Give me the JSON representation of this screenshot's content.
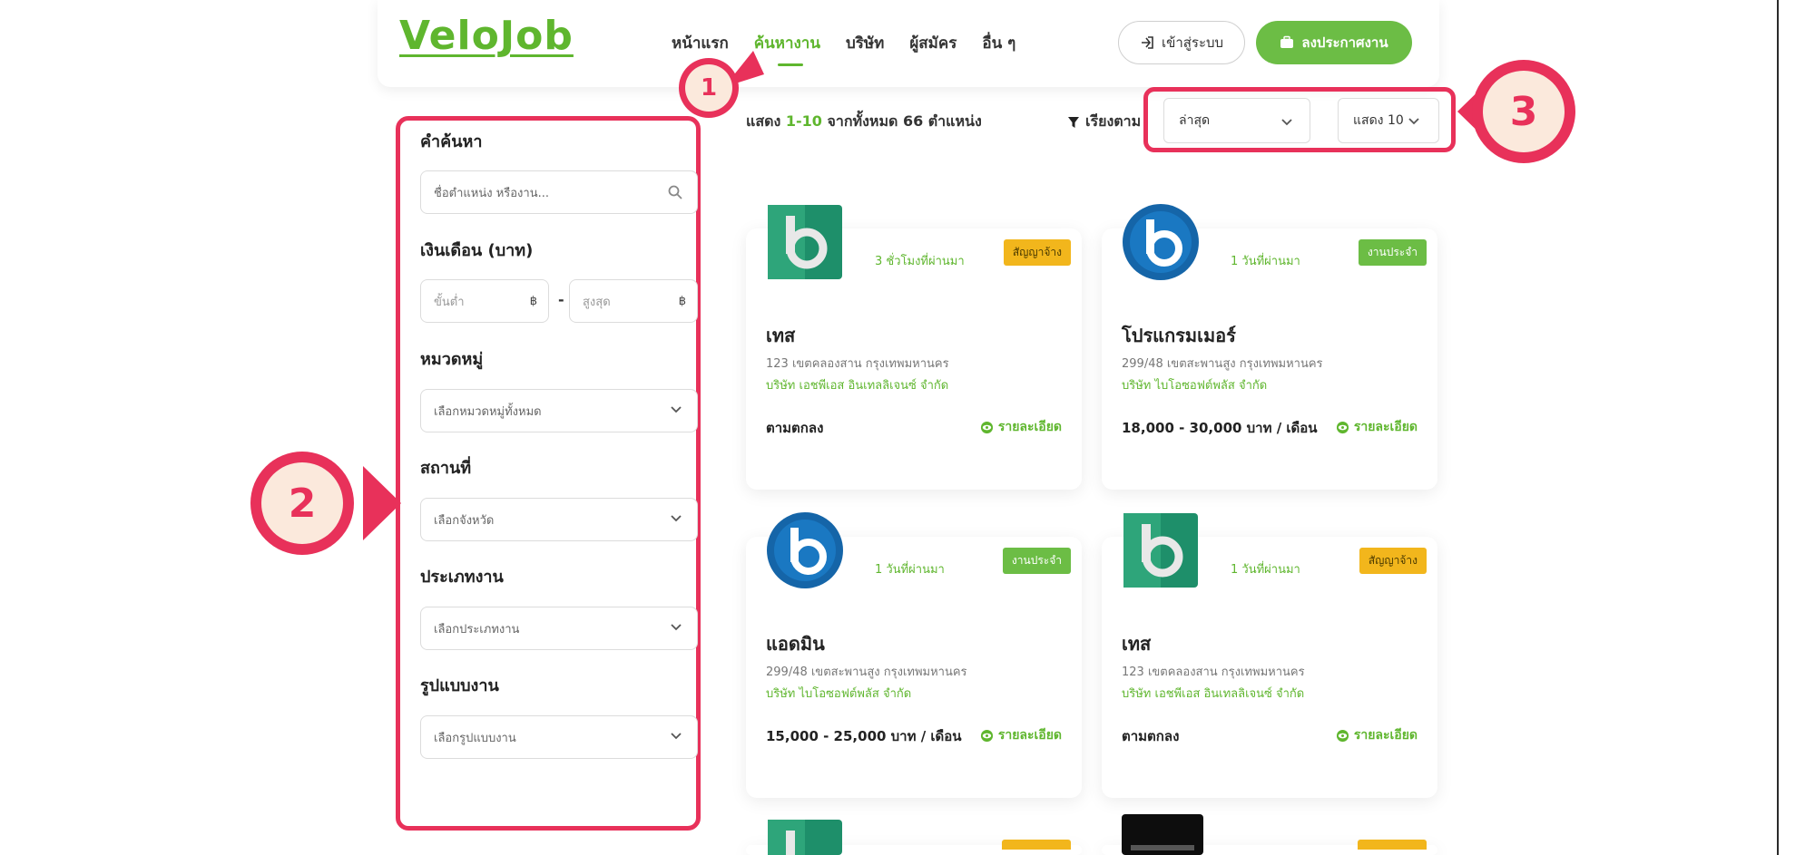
{
  "header": {
    "logo": "VeloJob",
    "nav": [
      {
        "label": "หน้าแรก",
        "active": false
      },
      {
        "label": "ค้นหางาน",
        "active": true
      },
      {
        "label": "บริษัท",
        "active": false
      },
      {
        "label": "ผู้สมัคร",
        "active": false
      },
      {
        "label": "อื่น ๆ",
        "active": false
      }
    ],
    "login_label": "เข้าสู่ระบบ",
    "post_job_label": "ลงประกาศงาน"
  },
  "filters": {
    "keyword_label": "คำค้นหา",
    "keyword_placeholder": "ชื่อตำแหน่ง หรืองาน...",
    "salary_label": "เงินเดือน (บาท)",
    "salary_min_placeholder": "ขั้นต่ำ",
    "salary_max_placeholder": "สูงสุด",
    "salary_dash": "-",
    "currency_symbol": "฿",
    "category_label": "หมวดหมู่",
    "category_value": "เลือกหมวดหมู่ทั้งหมด",
    "location_label": "สถานที่",
    "location_value": "เลือกจังหวัด",
    "jobtype_label": "ประเภทงาน",
    "jobtype_value": "เลือกประเภทงาน",
    "workstyle_label": "รูปแบบงาน",
    "workstyle_value": "เลือกรูปแบบงาน"
  },
  "results": {
    "prefix": "แสดง",
    "range": "1-10",
    "suffix": "จากทั้งหมด 66 ตำแหน่ง",
    "sort_label": "เรียงตาม",
    "sort_value": "ล่าสุด",
    "show_value": "แสดง 10"
  },
  "jobs": [
    {
      "title": "เทส",
      "posted": "3 ชั่วโมงที่ผ่านมา",
      "badge": "สัญญาจ้าง",
      "badge_color": "yellow",
      "address": "123 เขตคลองสาน กรุงเทพมหานคร",
      "company": "บริษัท เอชพีเอส อินเทลลิเจนซ์ จำกัด",
      "salary": "ตามตกลง",
      "detail": "รายละเอียด",
      "logo_style": "green"
    },
    {
      "title": "โปรแกรมเมอร์",
      "posted": "1 วันที่ผ่านมา",
      "badge": "งานประจำ",
      "badge_color": "green",
      "address": "299/48 เขตสะพานสูง กรุงเทพมหานคร",
      "company": "บริษัท ไบโอซอฟต์พลัส จำกัด",
      "salary": "18,000 - 30,000 บาท / เดือน",
      "detail": "รายละเอียด",
      "logo_style": "blue"
    },
    {
      "title": "แอดมิน",
      "posted": "1 วันที่ผ่านมา",
      "badge": "งานประจำ",
      "badge_color": "green",
      "address": "299/48 เขตสะพานสูง กรุงเทพมหานคร",
      "company": "บริษัท ไบโอซอฟต์พลัส จำกัด",
      "salary": "15,000 - 25,000 บาท / เดือน",
      "detail": "รายละเอียด",
      "logo_style": "blue"
    },
    {
      "title": "เทส",
      "posted": "1 วันที่ผ่านมา",
      "badge": "สัญญาจ้าง",
      "badge_color": "yellow",
      "address": "123 เขตคลองสาน กรุงเทพมหานคร",
      "company": "บริษัท เอชพีเอส อินเทลลิเจนซ์ จำกัด",
      "salary": "ตามตกลง",
      "detail": "รายละเอียด",
      "logo_style": "green"
    }
  ],
  "markers": [
    "1",
    "2",
    "3"
  ],
  "colors": {
    "brand_green": "#6cbd45",
    "annotation_red": "#e8315a",
    "badge_yellow": "#f2b61c"
  }
}
